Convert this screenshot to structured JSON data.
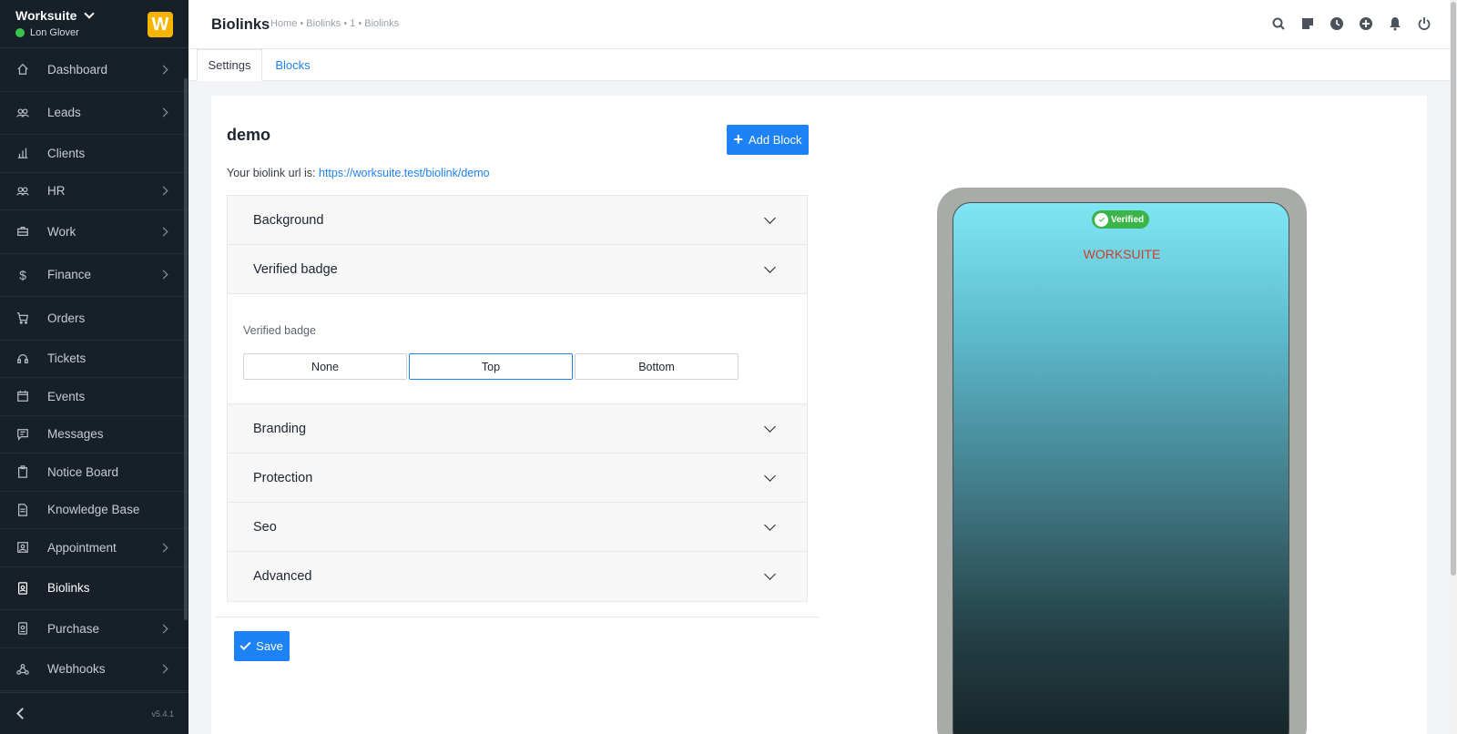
{
  "sidebar": {
    "brand": "Worksuite",
    "user": "Lon Glover",
    "logo_letter": "W",
    "version": "v5.4.1",
    "items": [
      {
        "label": "Dashboard"
      },
      {
        "label": "Leads"
      },
      {
        "label": "Clients"
      },
      {
        "label": "HR"
      },
      {
        "label": "Work"
      },
      {
        "label": "Finance"
      },
      {
        "label": "Orders"
      },
      {
        "label": "Tickets"
      },
      {
        "label": "Events"
      },
      {
        "label": "Messages"
      },
      {
        "label": "Notice Board"
      },
      {
        "label": "Knowledge Base"
      },
      {
        "label": "Appointment"
      },
      {
        "label": "Biolinks"
      },
      {
        "label": "Purchase"
      },
      {
        "label": "Webhooks"
      }
    ]
  },
  "header": {
    "title": "Biolinks",
    "breadcrumb": "Home • Biolinks • 1 • Biolinks"
  },
  "tabs": {
    "settings": "Settings",
    "blocks": "Blocks"
  },
  "main": {
    "title": "demo",
    "add_block": "Add Block",
    "url_prefix": "Your biolink url is:",
    "url": "https://worksuite.test/biolink/demo",
    "sections": {
      "background": "Background",
      "verified_badge": "Verified badge",
      "branding": "Branding",
      "protection": "Protection",
      "seo": "Seo",
      "advanced": "Advanced"
    },
    "verified_badge_label": "Verified badge",
    "options": {
      "none": "None",
      "top": "Top",
      "bottom": "Bottom"
    },
    "selected_option": "Top",
    "save": "Save"
  },
  "preview": {
    "badge": "Verified",
    "brand": "WORKSUITE"
  },
  "colors": {
    "accent": "#1d82f5",
    "sidebar_bg": "#171f29",
    "badge": "#3bb54a",
    "brand_text": "#c83f28"
  }
}
